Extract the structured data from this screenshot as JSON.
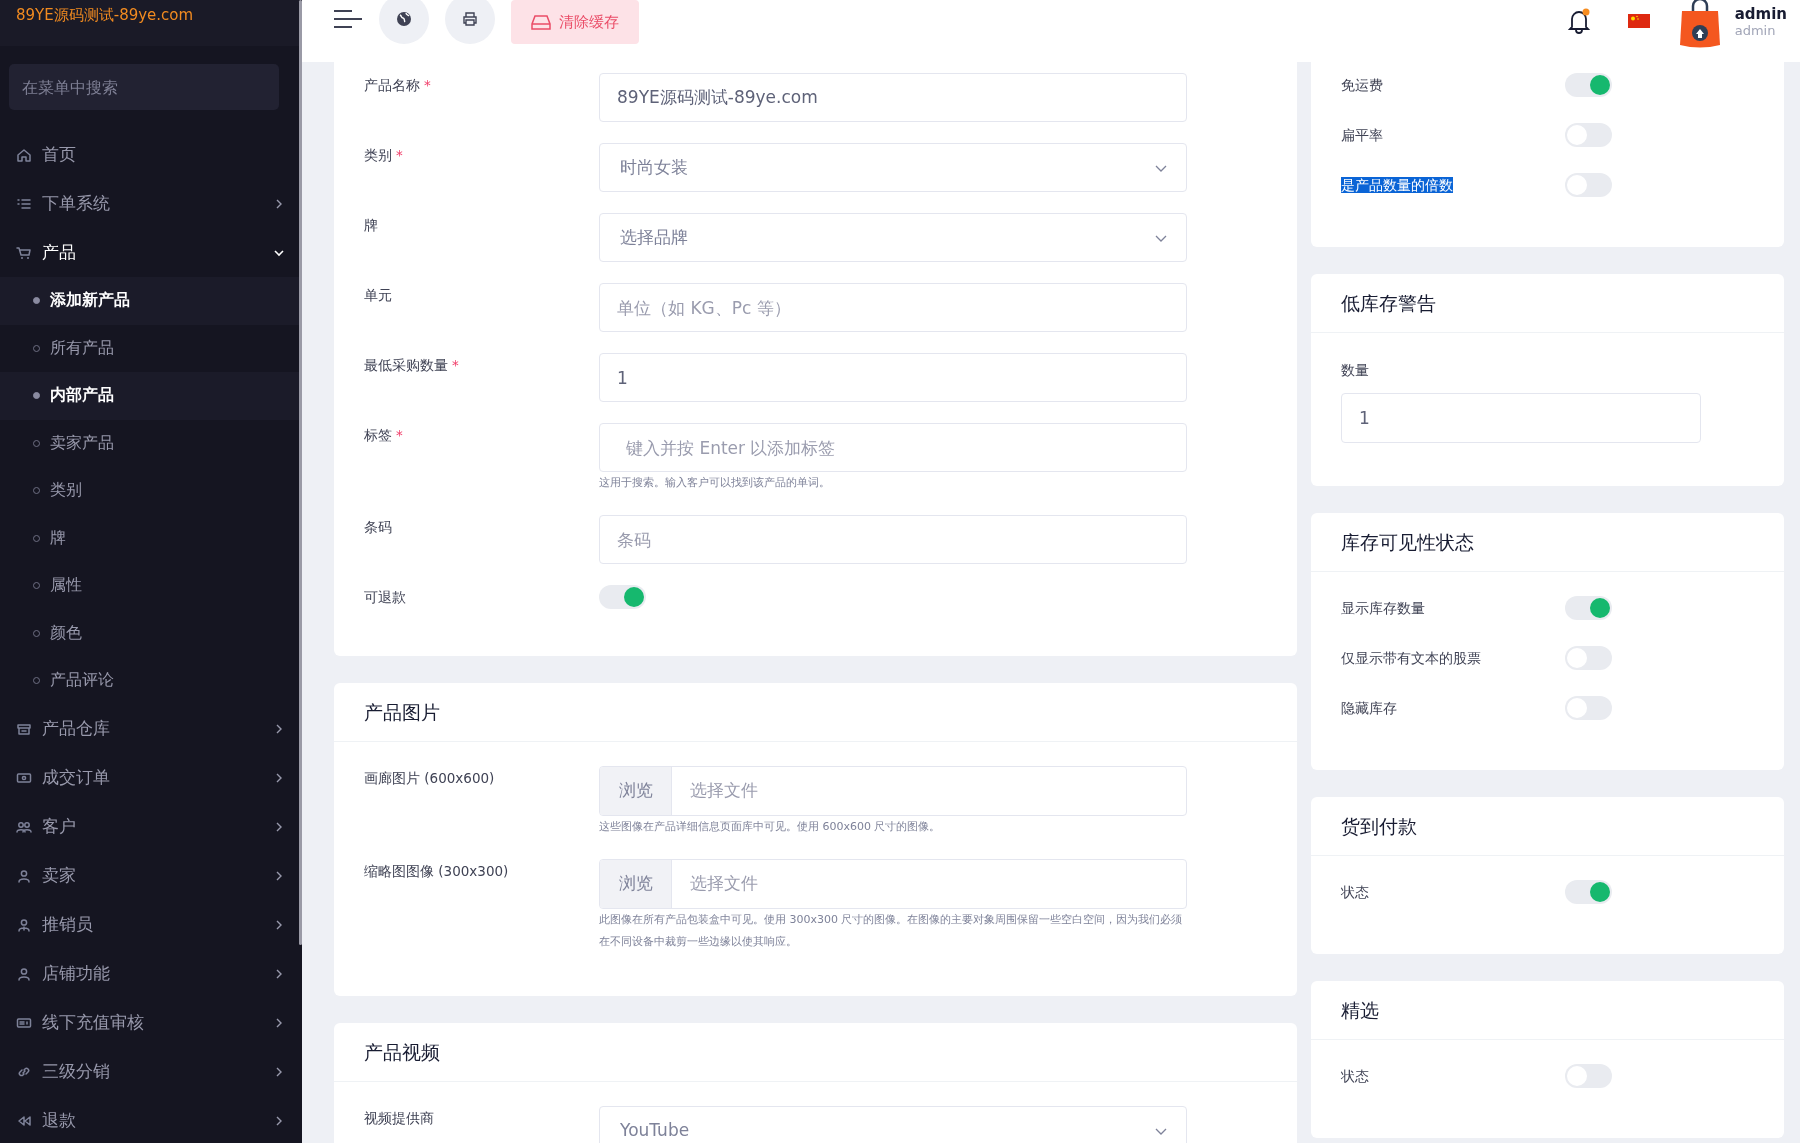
{
  "brand": "89YE源码测试-89ye.com",
  "sidebar": {
    "search": {
      "placeholder": "在菜单中搜索"
    },
    "items": [
      {
        "label": "首页",
        "kind": "link"
      },
      {
        "label": "下单系统",
        "kind": "group",
        "expanded": false
      },
      {
        "label": "产品",
        "kind": "group",
        "expanded": true,
        "children": [
          {
            "label": "添加新产品",
            "selected": true
          },
          {
            "label": "所有产品",
            "selected": false
          },
          {
            "label": "内部产品",
            "selected": true
          },
          {
            "label": "卖家产品",
            "selected": false
          },
          {
            "label": "类别",
            "selected": false
          },
          {
            "label": "牌",
            "selected": false
          },
          {
            "label": "属性",
            "selected": false
          },
          {
            "label": "颜色",
            "selected": false
          },
          {
            "label": "产品评论",
            "selected": false
          }
        ]
      },
      {
        "label": "产品仓库",
        "kind": "group",
        "expanded": false
      },
      {
        "label": "成交订单",
        "kind": "group",
        "expanded": false
      },
      {
        "label": "客户",
        "kind": "group",
        "expanded": false
      },
      {
        "label": "卖家",
        "kind": "group",
        "expanded": false
      },
      {
        "label": "推销员",
        "kind": "group",
        "expanded": false
      },
      {
        "label": "店铺功能",
        "kind": "group",
        "expanded": false
      },
      {
        "label": "线下充值审核",
        "kind": "group",
        "expanded": false
      },
      {
        "label": "三级分销",
        "kind": "group",
        "expanded": false
      },
      {
        "label": "退款",
        "kind": "group",
        "expanded": false
      }
    ]
  },
  "topbar": {
    "clear_cache_button": "清除缓存",
    "notifications": {
      "unread": true
    },
    "user": {
      "name": "admin",
      "role": "admin"
    }
  },
  "left_cards": [
    {
      "fields": [
        {
          "label": "产品名称",
          "required_mark": "*",
          "kind": "text",
          "value": "89YE源码测试-89ye.com"
        },
        {
          "label": "类别",
          "required_mark": "*",
          "kind": "select",
          "value": "时尚女装"
        },
        {
          "label": "牌",
          "kind": "select",
          "value": "选择品牌"
        },
        {
          "label": "单元",
          "kind": "text",
          "placeholder": "单位（如 KG、Pc 等）"
        },
        {
          "label": "最低采购数量",
          "required_mark": "*",
          "kind": "text",
          "value": "1"
        },
        {
          "label": "标签",
          "required_mark": "*",
          "kind": "tags",
          "placeholder": "键入并按 Enter 以添加标签",
          "help": "这用于搜索。输入客户可以找到该产品的单词。"
        },
        {
          "label": "条码",
          "kind": "text",
          "placeholder": "条码"
        },
        {
          "label": "可退款",
          "kind": "toggle",
          "on": true
        }
      ]
    },
    {
      "title": "产品图片",
      "fields": [
        {
          "label": "画廊图片 (600x600)",
          "kind": "file",
          "button": "浏览",
          "placeholder": "选择文件",
          "help": "这些图像在产品详细信息页面库中可见。使用 600x600 尺寸的图像。"
        },
        {
          "label": "缩略图图像 (300x300)",
          "kind": "file",
          "button": "浏览",
          "placeholder": "选择文件",
          "help": "此图像在所有产品包装盒中可见。使用 300x300 尺寸的图像。在图像的主要对象周围保留一些空白空间，因为我们必须在不同设备中裁剪一些边缘以使其响应。"
        }
      ]
    },
    {
      "title": "产品视频",
      "fields": [
        {
          "label": "视频提供商",
          "kind": "select",
          "value": "YouTube"
        }
      ]
    }
  ],
  "right_cards": [
    {
      "rows": [
        {
          "label": "免运费",
          "kind": "toggle",
          "on": true,
          "highlighted": false
        },
        {
          "label": "扁平率",
          "kind": "toggle",
          "on": false,
          "highlighted": false
        },
        {
          "label": "是产品数量的倍数",
          "kind": "toggle",
          "on": false,
          "highlighted": true
        }
      ]
    },
    {
      "title": "低库存警告",
      "rows": [
        {
          "label": "数量",
          "kind": "number",
          "value": "1"
        }
      ]
    },
    {
      "title": "库存可见性状态",
      "rows": [
        {
          "label": "显示库存数量",
          "kind": "toggle",
          "on": true,
          "highlighted": false
        },
        {
          "label": "仅显示带有文本的股票",
          "kind": "toggle",
          "on": false,
          "highlighted": false
        },
        {
          "label": "隐藏库存",
          "kind": "toggle",
          "on": false,
          "highlighted": false
        }
      ]
    },
    {
      "title": "货到付款",
      "rows": [
        {
          "label": "状态",
          "kind": "toggle",
          "on": true,
          "highlighted": false
        }
      ]
    },
    {
      "title": "精选",
      "rows": [
        {
          "label": "状态",
          "kind": "toggle",
          "on": false,
          "highlighted": false
        }
      ]
    }
  ]
}
